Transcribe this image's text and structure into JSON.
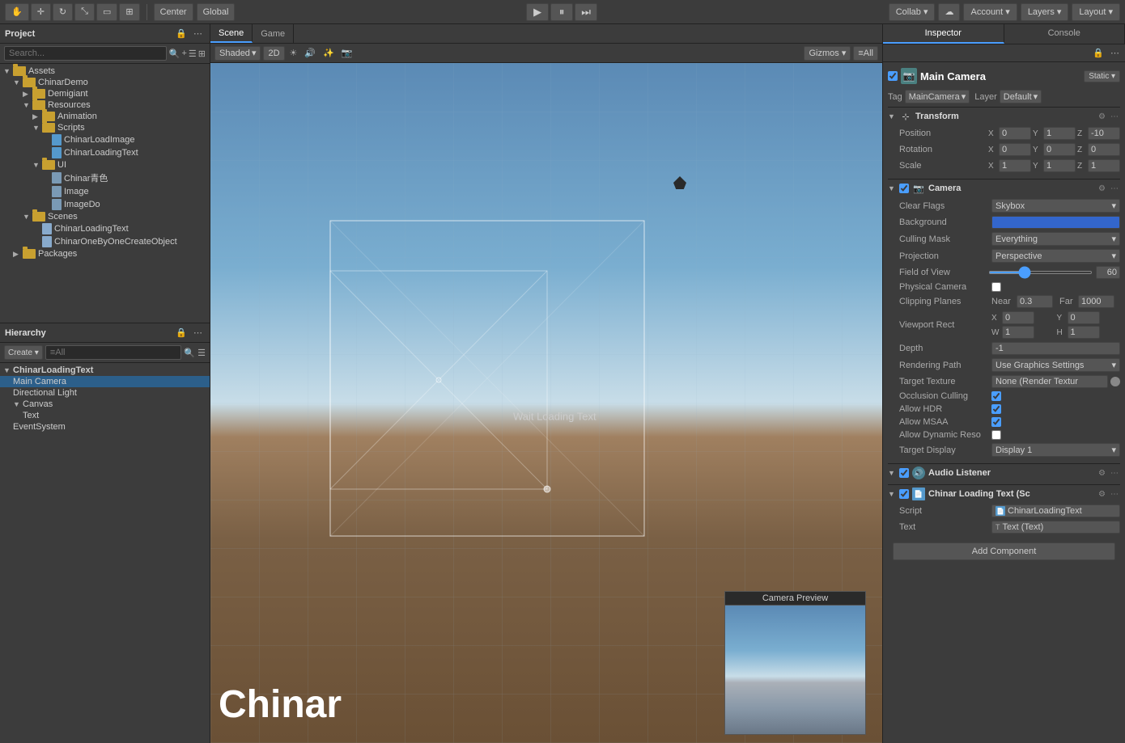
{
  "toolbar": {
    "center_label": "Center",
    "global_label": "Global",
    "collab_label": "Collab ▾",
    "account_label": "Account ▾",
    "layers_label": "Layers ▾",
    "layout_label": "Layout ▾"
  },
  "scene_tab": {
    "scene_label": "Scene",
    "game_label": "Game",
    "shaded_label": "Shaded",
    "twod_label": "2D",
    "gizmos_label": "Gizmos ▾",
    "all_layers_label": "≡All"
  },
  "viewport": {
    "wait_text": "Wait Loading Text",
    "chinar_text": "Chinar",
    "camera_preview_title": "Camera Preview"
  },
  "left_panel": {
    "project_title": "Project",
    "assets_label": "Assets",
    "hierarchy_title": "Hierarchy",
    "create_label": "Create ▾",
    "all_label": "≡All"
  },
  "assets_tree": [
    {
      "indent": 0,
      "type": "folder",
      "label": "Assets",
      "expanded": true
    },
    {
      "indent": 1,
      "type": "folder",
      "label": "ChinarDemo",
      "expanded": true
    },
    {
      "indent": 2,
      "type": "folder",
      "label": "Demigiant",
      "expanded": false
    },
    {
      "indent": 2,
      "type": "folder",
      "label": "Resources",
      "expanded": true
    },
    {
      "indent": 3,
      "type": "folder",
      "label": "Animation",
      "expanded": false
    },
    {
      "indent": 3,
      "type": "folder",
      "label": "Scripts",
      "expanded": true
    },
    {
      "indent": 4,
      "type": "cs",
      "label": "ChinarLoadImage"
    },
    {
      "indent": 4,
      "type": "cs",
      "label": "ChinarLoadingText"
    },
    {
      "indent": 3,
      "type": "folder",
      "label": "UI",
      "expanded": true
    },
    {
      "indent": 4,
      "type": "file",
      "label": "Chinar青色"
    },
    {
      "indent": 4,
      "type": "file",
      "label": "Image"
    },
    {
      "indent": 4,
      "type": "file",
      "label": "ImageDo"
    },
    {
      "indent": 2,
      "type": "folder",
      "label": "Scenes",
      "expanded": true
    },
    {
      "indent": 3,
      "type": "scene",
      "label": "ChinarLoadingText"
    },
    {
      "indent": 3,
      "type": "scene",
      "label": "ChinarOneByOneCreateObject"
    },
    {
      "indent": 1,
      "type": "folder",
      "label": "Packages",
      "expanded": false
    }
  ],
  "hierarchy_tree": [
    {
      "indent": 0,
      "type": "scene",
      "label": "ChinarLoadingText",
      "expanded": true
    },
    {
      "indent": 1,
      "type": "gameobj",
      "label": "Main Camera",
      "selected": true
    },
    {
      "indent": 1,
      "type": "gameobj",
      "label": "Directional Light"
    },
    {
      "indent": 1,
      "type": "gameobj",
      "label": "Canvas",
      "expanded": true
    },
    {
      "indent": 2,
      "type": "gameobj",
      "label": "Text"
    },
    {
      "indent": 1,
      "type": "gameobj",
      "label": "EventSystem"
    }
  ],
  "inspector": {
    "title": "Inspector",
    "console_label": "Console",
    "obj_name": "Main Camera",
    "static_label": "Static ▾",
    "tag_label": "Tag",
    "tag_value": "MainCamera",
    "layer_label": "Layer",
    "layer_value": "Default",
    "transform_title": "Transform",
    "position_label": "Position",
    "pos_x": "0",
    "pos_y": "1",
    "pos_z": "-10",
    "rotation_label": "Rotation",
    "rot_x": "0",
    "rot_y": "0",
    "rot_z": "0",
    "scale_label": "Scale",
    "scale_x": "1",
    "scale_y": "1",
    "scale_z": "1",
    "camera_title": "Camera",
    "clear_flags_label": "Clear Flags",
    "clear_flags_value": "Skybox",
    "background_label": "Background",
    "culling_mask_label": "Culling Mask",
    "culling_mask_value": "Everything",
    "projection_label": "Projection",
    "projection_value": "Perspective",
    "fov_label": "Field of View",
    "fov_value": "60",
    "physical_camera_label": "Physical Camera",
    "clipping_planes_label": "Clipping Planes",
    "near_label": "Near",
    "near_value": "0.3",
    "far_label": "Far",
    "far_value": "1000",
    "viewport_rect_label": "Viewport Rect",
    "vp_x": "0",
    "vp_y": "0",
    "vp_w": "1",
    "vp_h": "1",
    "depth_label": "Depth",
    "depth_value": "-1",
    "rendering_path_label": "Rendering Path",
    "rendering_path_value": "Use Graphics Settings",
    "target_texture_label": "Target Texture",
    "target_texture_value": "None (Render Textur",
    "occlusion_culling_label": "Occlusion Culling",
    "allow_hdr_label": "Allow HDR",
    "allow_msaa_label": "Allow MSAA",
    "allow_dynamic_label": "Allow Dynamic Reso",
    "target_display_label": "Target Display",
    "target_display_value": "Display 1",
    "audio_listener_title": "Audio Listener",
    "chinar_script_title": "Chinar Loading Text (Sc",
    "script_label": "Script",
    "script_value": "ChinarLoadingText",
    "text_label": "Text",
    "text_value": "Text (Text)",
    "add_component_label": "Add Component"
  }
}
